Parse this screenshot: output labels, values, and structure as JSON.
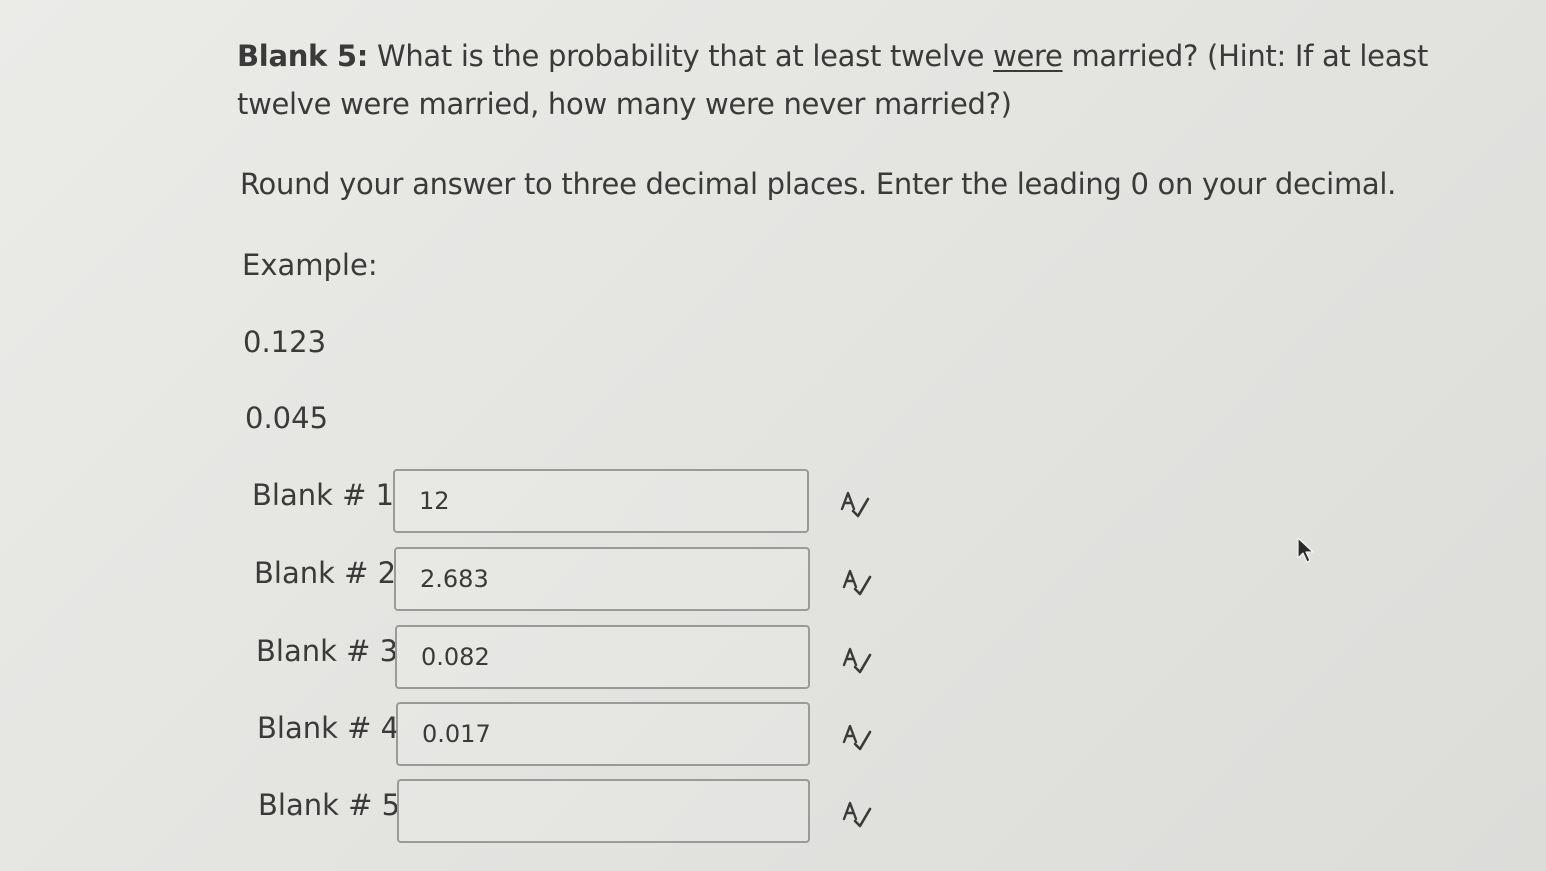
{
  "question": {
    "prefix": "Blank 5:",
    "part1": " What is the probability that at least twelve ",
    "underlined": "were",
    "part2": " married? (Hint: If at least twelve were married, how many were never married?)"
  },
  "instruction": "Round your answer to three decimal places. Enter the leading 0 on your decimal.",
  "example": {
    "label": "Example:",
    "values": [
      "0.123",
      "0.045"
    ]
  },
  "blanks": [
    {
      "label": "Blank # 1",
      "value": "12"
    },
    {
      "label": "Blank # 2",
      "value": "2.683"
    },
    {
      "label": "Blank # 3",
      "value": "0.082"
    },
    {
      "label": "Blank # 4",
      "value": "0.017"
    },
    {
      "label": "Blank # 5",
      "value": ""
    }
  ],
  "icons": {
    "spellcheck": "spellcheck-icon",
    "cursor": "mouse-pointer-icon"
  },
  "colors": {
    "background": "#e4e4e1",
    "text": "#3a3a3a",
    "input_border": "#9a9a98"
  }
}
